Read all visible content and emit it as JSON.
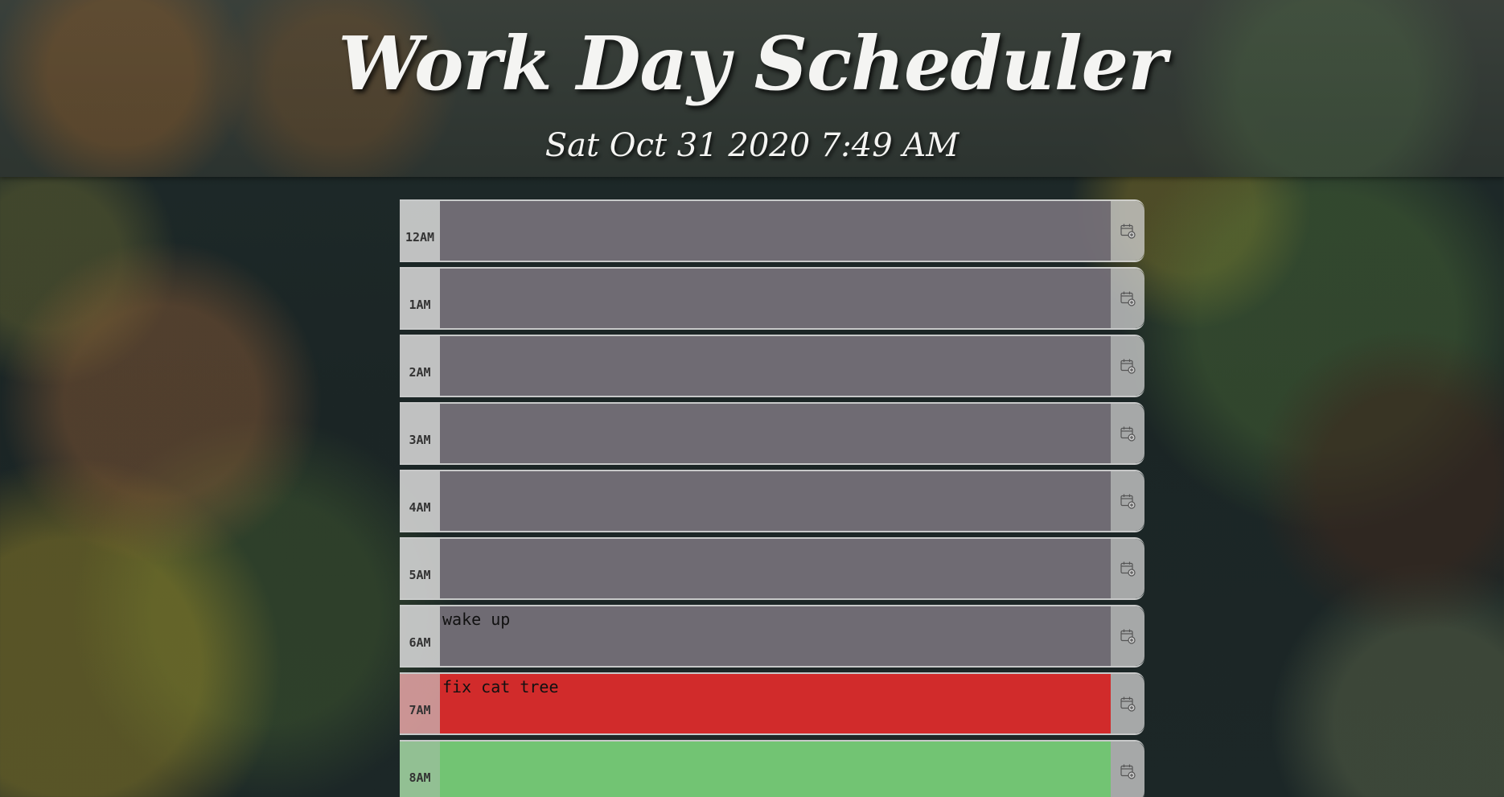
{
  "header": {
    "title": "Work Day Scheduler",
    "current_date": "Sat Oct 31 2020 7:49 AM"
  },
  "colors": {
    "past": "#767179",
    "present": "#d82b2b",
    "future": "#77cc77"
  },
  "save_icon": "calendar-plus-icon",
  "time_blocks": [
    {
      "hour": "12AM",
      "text": "",
      "state": "past"
    },
    {
      "hour": "1AM",
      "text": "",
      "state": "past"
    },
    {
      "hour": "2AM",
      "text": "",
      "state": "past"
    },
    {
      "hour": "3AM",
      "text": "",
      "state": "past"
    },
    {
      "hour": "4AM",
      "text": "",
      "state": "past"
    },
    {
      "hour": "5AM",
      "text": "",
      "state": "past"
    },
    {
      "hour": "6AM",
      "text": "wake up",
      "state": "past"
    },
    {
      "hour": "7AM",
      "text": "fix cat tree",
      "state": "present"
    },
    {
      "hour": "8AM",
      "text": "",
      "state": "future"
    }
  ]
}
